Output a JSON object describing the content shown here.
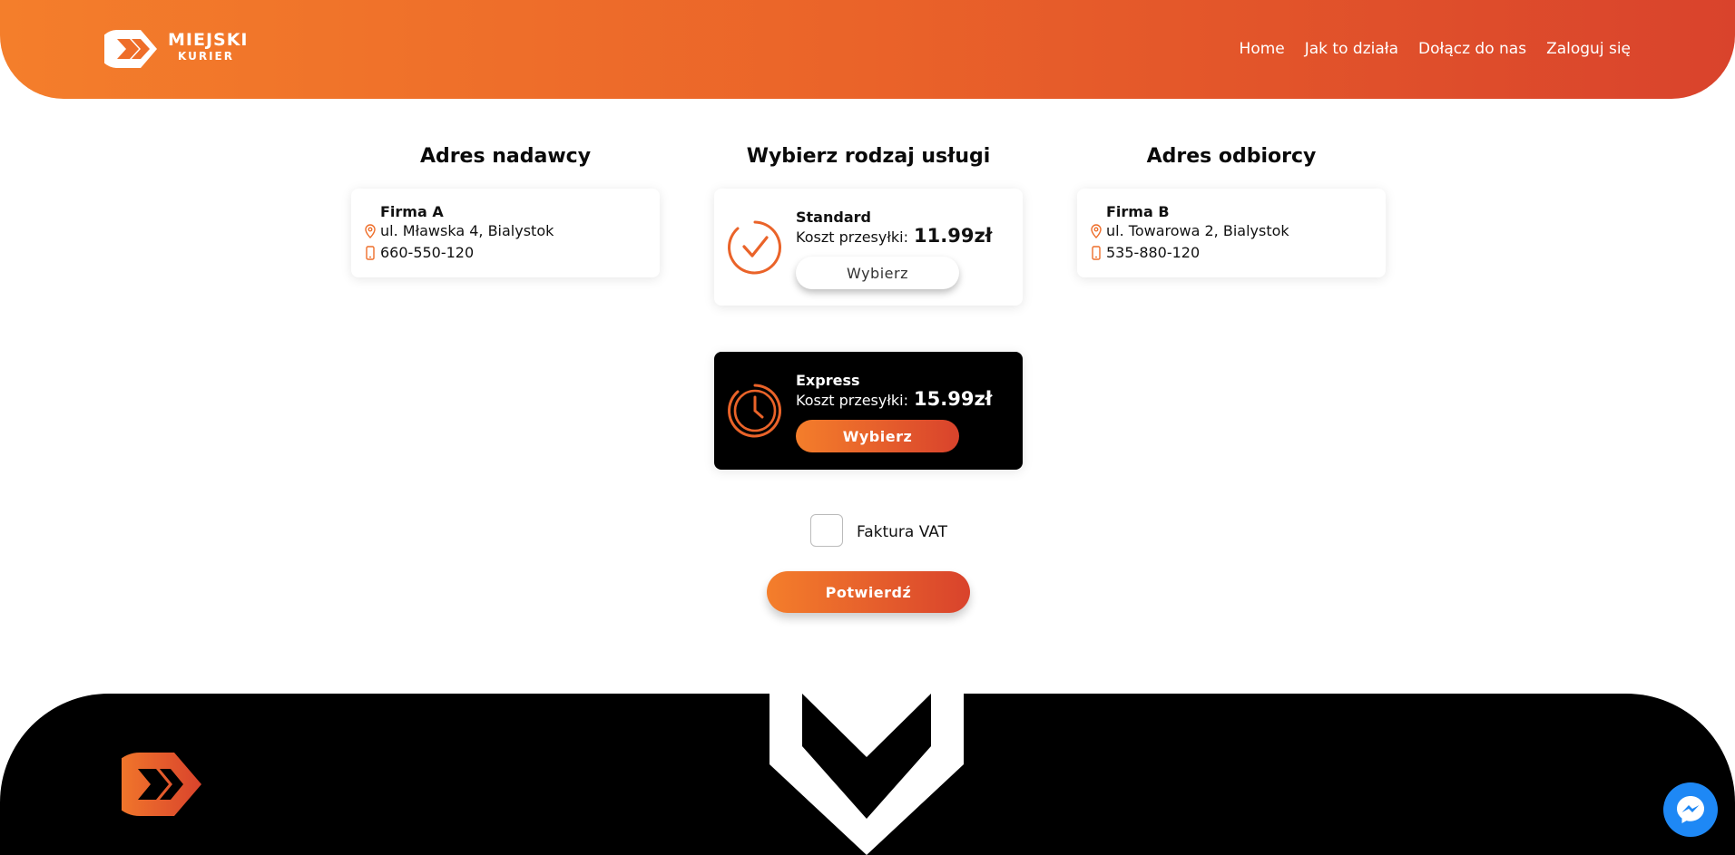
{
  "brand": {
    "line1": "MIEJSKI",
    "line2": "KURIER"
  },
  "nav": {
    "items": [
      {
        "label": "Home"
      },
      {
        "label": "Jak to działa"
      },
      {
        "label": "Dołącz do nas"
      },
      {
        "label": "Zaloguj się"
      }
    ]
  },
  "sender": {
    "title": "Adres nadawcy",
    "name": "Firma A",
    "address": "ul. Mławska 4, Bialystok",
    "phone": "660-550-120"
  },
  "services": {
    "title": "Wybierz rodzaj usługi",
    "cost_label": "Koszt przesyłki:",
    "items": [
      {
        "name": "Standard",
        "price": "11.99zł",
        "button": "Wybierz",
        "icon": "check-circle-icon"
      },
      {
        "name": "Express",
        "price": "15.99zł",
        "button": "Wybierz",
        "icon": "clock-icon"
      }
    ]
  },
  "recipient": {
    "title": "Adres odbiorcy",
    "name": "Firma B",
    "address": "ul. Towarowa 2, Bialystok",
    "phone": "535-880-120"
  },
  "invoice": {
    "label": "Faktura VAT",
    "checked": false
  },
  "confirm": {
    "label": "Potwierdź"
  },
  "colors": {
    "accent_start": "#f47e2b",
    "accent_end": "#d9432c",
    "footer": "#000000",
    "messenger": "#1e88f5"
  }
}
